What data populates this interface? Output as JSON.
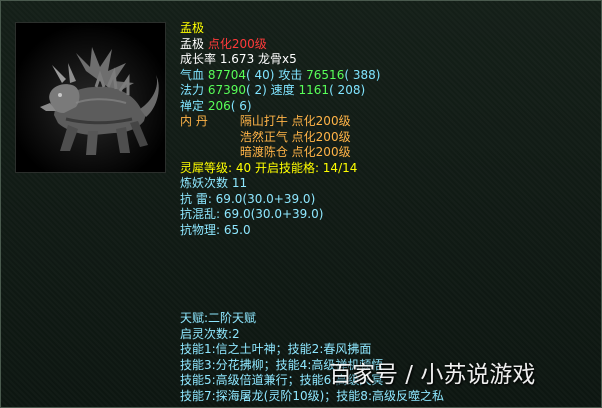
{
  "pet": {
    "title": "孟极",
    "name": "孟极",
    "level_tag": "点化200级",
    "growth_label": "成长率",
    "growth_value": "1.673",
    "bone": "龙骨x5",
    "hp_label": "气血",
    "hp_value": "87704",
    "hp_points": "( 40)",
    "atk_label": "攻击",
    "atk_value": "76516",
    "atk_points": "( 388)",
    "mp_label": "法力",
    "mp_value": "67390",
    "mp_points": "( 2)",
    "spd_label": "速度",
    "spd_value": "1161",
    "spd_points": "( 208)",
    "focus_label": "禅定",
    "focus_value": "206",
    "focus_points": "( 6)",
    "neidan_label": "内  丹",
    "neidan": [
      {
        "name": "隔山打牛",
        "level": "点化200级"
      },
      {
        "name": "浩然正气",
        "level": "点化200级"
      },
      {
        "name": "暗渡陈仓",
        "level": "点化200级"
      }
    ],
    "spirit": "灵犀等级: 40 开启技能格: 14/14",
    "refine": "炼妖次数 11",
    "resist_thunder": "抗  雷: 69.0(30.0+39.0)",
    "resist_chaos": "抗混乱: 69.0(30.0+39.0)",
    "resist_physical": "抗物理: 65.0"
  },
  "talent": "天赋:二阶天赋",
  "awaken": "启灵次数:2",
  "skills": [
    "技能1:信之土叶神；技能2:春风拂面",
    "技能3:分花拂柳；技能4:高级禅机顿悟",
    "技能5:高级倍道兼行；技能6:高级天冥",
    "技能7:探海屠龙(灵阶10级)；技能8:高级反噬之私"
  ],
  "watermark": "百家号 / 小苏说游戏",
  "colors": {
    "title": "#ffff00",
    "level_tag": "#ff3a3a",
    "stats": "#80e4ff",
    "values": "#58ff58",
    "neidan": "#ffb347",
    "spirit": "#ffff00",
    "resist": "#8ee7ff"
  }
}
